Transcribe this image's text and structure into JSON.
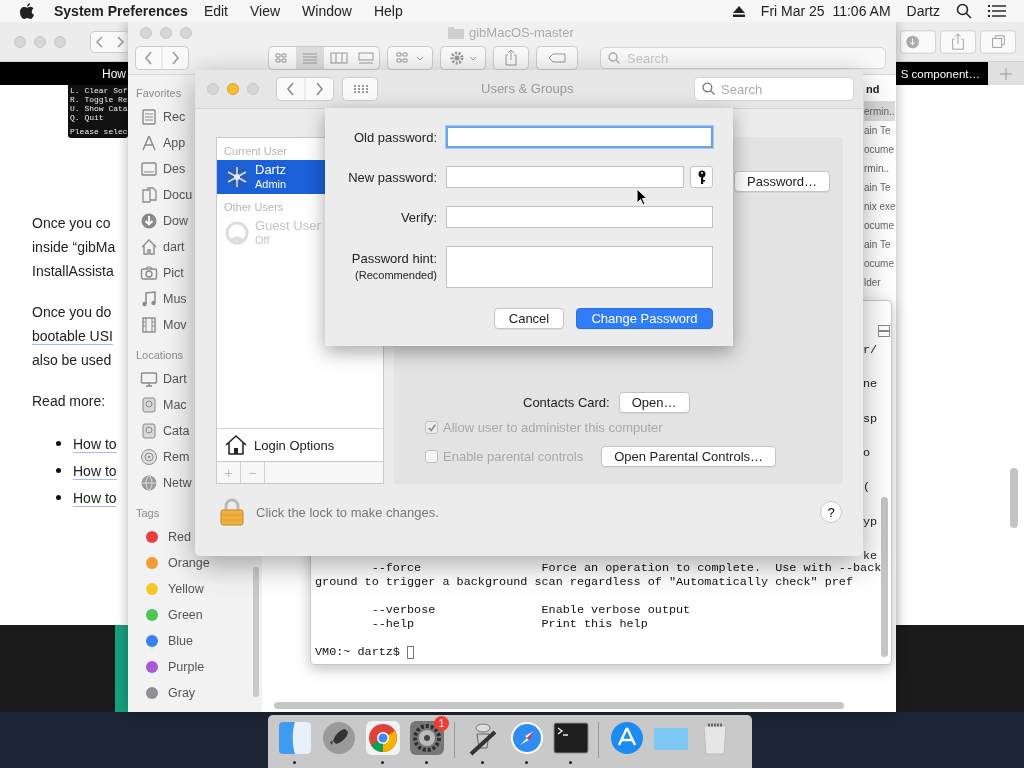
{
  "menu_bar": {
    "app_name": "System Preferences",
    "menus": [
      "Edit",
      "View",
      "Window",
      "Help"
    ],
    "clock": "Fri Mar 25  11:06 AM",
    "user": "Dartz"
  },
  "browser": {
    "tab_bar_texts": [
      "How",
      "S component…"
    ],
    "thumbnail_groups": [
      [
        "L. Clear Sof",
        "R. Toggle Re",
        "U. Show Cata",
        "Q. Quit"
      ],
      [
        "Please selec"
      ]
    ],
    "paragraphs": [
      [
        {
          "text": "Once you co",
          "link": false
        },
        {
          "text": "inside “gibMa",
          "link": false
        },
        {
          "text": "InstallAssista",
          "link": false
        }
      ],
      [
        {
          "text": "Once you do",
          "link": false
        },
        {
          "text": "bootable USI",
          "link": true
        },
        {
          "text": "also be used",
          "link": false
        }
      ],
      [
        {
          "text": "Read more:",
          "link": false
        }
      ]
    ],
    "bullets": [
      "How to",
      "How to",
      "How to"
    ]
  },
  "finder": {
    "title": "gibMacOS-master",
    "search_placeholder": "Search",
    "sections": [
      {
        "heading": "Favorites",
        "items": [
          {
            "kind": "recents",
            "label": "Rec"
          },
          {
            "kind": "applications",
            "label": "App"
          },
          {
            "kind": "desktop",
            "label": "Des"
          },
          {
            "kind": "documents",
            "label": "Docu"
          },
          {
            "kind": "downloads",
            "label": "Dow"
          },
          {
            "kind": "home",
            "label": "dart"
          },
          {
            "kind": "pictures",
            "label": "Pict"
          },
          {
            "kind": "music",
            "label": "Mus"
          },
          {
            "kind": "movies",
            "label": "Mov"
          }
        ]
      },
      {
        "heading": "Locations",
        "items": [
          {
            "kind": "computer",
            "label": "Dart"
          },
          {
            "kind": "disk",
            "label": "Mac"
          },
          {
            "kind": "disk",
            "label": "Cata"
          },
          {
            "kind": "disc",
            "label": "Rem"
          },
          {
            "kind": "network",
            "label": "Netw"
          }
        ]
      }
    ],
    "tags_heading": "Tags",
    "tags": [
      {
        "label": "Red",
        "color": "#e8403f"
      },
      {
        "label": "Orange",
        "color": "#f39a32"
      },
      {
        "label": "Yellow",
        "color": "#f5c82a"
      },
      {
        "label": "Green",
        "color": "#4cc555"
      },
      {
        "label": "Blue",
        "color": "#3a80f5"
      },
      {
        "label": "Purple",
        "color": "#a95bd6"
      },
      {
        "label": "Gray",
        "color": "#8e8e93"
      }
    ],
    "kind_header": "nd",
    "kinds": [
      {
        "text": "ermin..",
        "selected": true
      },
      {
        "text": "ain Te",
        "selected": false
      },
      {
        "text": "ocume",
        "selected": false
      },
      {
        "text": "rmin..",
        "selected": false
      },
      {
        "text": "ain Te",
        "selected": false
      },
      {
        "text": "nix exe",
        "selected": false
      },
      {
        "text": "ocume",
        "selected": false
      },
      {
        "text": "ain Te",
        "selected": false
      },
      {
        "text": "ocume",
        "selected": false
      },
      {
        "text": "lder",
        "selected": false
      }
    ]
  },
  "terminal": {
    "edge_fragments": [
      "r/",
      "ne",
      "sp",
      "o",
      "(",
      "yp",
      "ke"
    ],
    "line_groups": [
      [
        "        --force                 Force an operation to complete.  Use with --back",
        "ground to trigger a background scan regardless of \"Automatically check\" pref"
      ],
      [
        "        --verbose               Enable verbose output",
        "        --help                  Print this help"
      ]
    ],
    "prompt": "VM0:~ dartz$"
  },
  "users_window": {
    "title": "Users & Groups",
    "search_placeholder": "Search",
    "lights": [
      {
        "lit": false
      },
      {
        "lit": true
      },
      {
        "lit": false
      }
    ],
    "users": [
      {
        "kind": "heading",
        "label": "Current User"
      },
      {
        "kind": "user",
        "avatar": {
          "kind": "snowflake"
        },
        "name": "Dartz",
        "role": "Admin",
        "selected": true,
        "disabled": false
      },
      {
        "kind": "heading",
        "label": "Other Users"
      },
      {
        "kind": "user",
        "avatar": {
          "kind": "silhouette"
        },
        "name": "Guest User",
        "role": "Off",
        "selected": false,
        "disabled": true
      }
    ],
    "login_options": "Login Options",
    "add_button": "+",
    "remove_button": "−",
    "password_button": "Password…",
    "contacts_label": "Contacts Card:",
    "contacts_button": "Open…",
    "checkboxes": [
      {
        "label": "Allow user to administer this computer",
        "checked": true,
        "disabled": true
      },
      {
        "label": "Enable parental controls",
        "checked": false,
        "disabled": true
      }
    ],
    "parental_button": "Open Parental Controls…",
    "lock_text": "Click the lock to make changes.",
    "help": "?"
  },
  "sheet": {
    "fields": [
      {
        "kind": "password",
        "label": "Old password:",
        "focused": true
      },
      {
        "kind": "password-with-key",
        "label": "New password:",
        "focused": false
      },
      {
        "kind": "password",
        "label": "Verify:",
        "focused": false
      },
      {
        "kind": "textarea",
        "label": "Password hint:",
        "note": "(Recommended)",
        "focused": false
      }
    ],
    "cancel": "Cancel",
    "confirm": "Change Password"
  },
  "dock": {
    "items": [
      {
        "kind": "finder",
        "running": true
      },
      {
        "kind": "launchpad",
        "running": false
      },
      {
        "kind": "chrome",
        "running": true
      },
      {
        "kind": "settings",
        "running": true,
        "badge": "1"
      },
      {
        "kind": "separator"
      },
      {
        "kind": "automator",
        "running": true
      },
      {
        "kind": "safari",
        "running": true
      },
      {
        "kind": "terminal",
        "running": true
      },
      {
        "kind": "separator"
      },
      {
        "kind": "appstore",
        "running": false
      },
      {
        "kind": "folder",
        "running": false
      },
      {
        "kind": "trash",
        "running": false
      }
    ]
  }
}
